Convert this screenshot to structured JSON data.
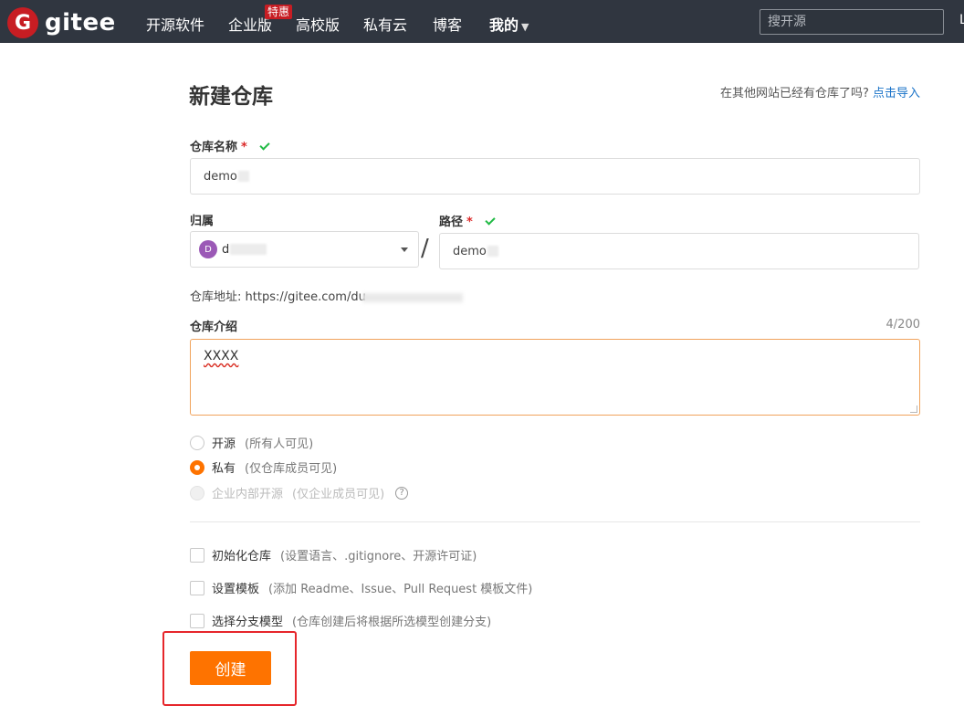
{
  "nav": {
    "logo_letter": "G",
    "logo_text": "gitee",
    "items": [
      "开源软件",
      "企业版",
      "高校版",
      "私有云",
      "博客",
      "我的"
    ],
    "badge": "特惠",
    "search_placeholder": "搜开源",
    "edge_char": "L"
  },
  "page": {
    "title": "新建仓库",
    "import_prompt": "在其他网站已经有仓库了吗?",
    "import_link": "点击导入"
  },
  "repo_name": {
    "label": "仓库名称",
    "required_mark": "*",
    "value": "demo"
  },
  "owner": {
    "label": "归属",
    "avatar_letter": "D",
    "value": "d"
  },
  "path": {
    "label": "路径",
    "required_mark": "*",
    "value": "demo",
    "separator": "/"
  },
  "address": {
    "prefix": "仓库地址: https://gitee.com/du"
  },
  "description": {
    "label": "仓库介绍",
    "counter": "4/200",
    "value": "XXXX"
  },
  "visibility": [
    {
      "label": "开源",
      "note": "(所有人可见)",
      "selected": false,
      "disabled": false
    },
    {
      "label": "私有",
      "note": "(仅仓库成员可见)",
      "selected": true,
      "disabled": false
    },
    {
      "label": "企业内部开源",
      "note": "(仅企业成员可见)",
      "selected": false,
      "disabled": true
    }
  ],
  "help_glyph": "?",
  "options": [
    {
      "label": "初始化仓库",
      "note": "(设置语言、.gitignore、开源许可证)"
    },
    {
      "label": "设置模板",
      "note": "(添加 Readme、Issue、Pull Request 模板文件)"
    },
    {
      "label": "选择分支模型",
      "note": "(仓库创建后将根据所选模型创建分支)"
    }
  ],
  "create_button": "创建",
  "colors": {
    "nav_bg": "#303640",
    "brand_red": "#c71d23",
    "accent_orange": "#fe7300",
    "link_blue": "#1a73c8",
    "success_green": "#21ba45",
    "highlight_red": "#e6262b"
  }
}
